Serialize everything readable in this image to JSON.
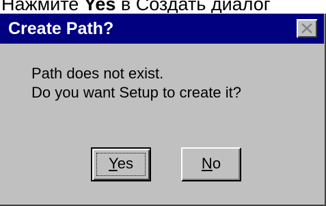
{
  "background_caption": {
    "text_before": "Нажмите ",
    "text_bold": "Yes",
    "text_after": " в Создать диалог"
  },
  "dialog": {
    "title": "Create Path?",
    "message_line1": "Path does not exist.",
    "message_line2": "Do you want Setup to create it?",
    "buttons": {
      "yes": {
        "mnemonic": "Y",
        "rest": "es"
      },
      "no": {
        "mnemonic": "N",
        "rest": "o"
      }
    }
  },
  "colors": {
    "titlebar": "#000080",
    "face": "#c0c0c0"
  },
  "icons": {
    "close": "close-icon"
  }
}
